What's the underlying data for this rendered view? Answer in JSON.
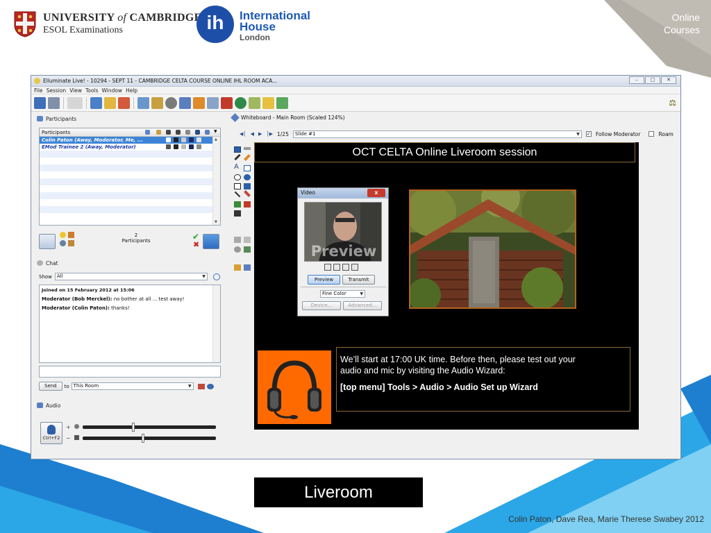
{
  "header": {
    "cambridge_line1a": "UNIVERSITY",
    "cambridge_of": "of",
    "cambridge_line1b": "CAMBRIDGE",
    "cambridge_line2": "ESOL Examinations",
    "ih_mark": "ih",
    "ih_line1": "International",
    "ih_line2": "House",
    "ih_line3": "London",
    "corner_line1": "Online",
    "corner_line2": "Courses"
  },
  "window": {
    "title": "Elluminate Live! - 10294 - SEPT 11 - CAMBRIDGE CELTA COURSE ONLINE IHL ROOM ACA...",
    "controls": [
      "–",
      "□",
      "✕"
    ],
    "menu": [
      "File",
      "Session",
      "View",
      "Tools",
      "Window",
      "Help"
    ]
  },
  "participants": {
    "panel_title": "Participants",
    "column_header": "Participants",
    "rows": [
      "Colin Paton (Away, Moderator, Me, ...",
      "EMod Trainee 2 (Away, Moderator)"
    ],
    "count": "2",
    "count_label": "Participants"
  },
  "chat": {
    "panel_title": "Chat",
    "show_label": "Show",
    "show_value": "All",
    "joined": "Joined on 15 February 2012 at 15:06",
    "messages": [
      {
        "sender": "Moderator (Bob Merckel):",
        "text": " no bother at all ... test away!"
      },
      {
        "sender": "Moderator (Colin Paton):",
        "text": " thanks!"
      }
    ],
    "send_label": "Send",
    "to_label": "to",
    "to_value": "This Room"
  },
  "audio": {
    "panel_title": "Audio",
    "ctrl_label": "Ctrl+F2",
    "plus": "+",
    "minus": "−",
    "mic_level": 0.38,
    "speaker_level": 0.45
  },
  "whiteboard": {
    "panel_title": "Whiteboard - Main Room (Scaled 124%)",
    "page": "1/25",
    "slide": "Slide #1",
    "follow_moderator": "Follow Moderator",
    "roam": "Roam",
    "board_title": "OCT CELTA Online Liveroom session",
    "info_line1": "We’ll start at 17:00 UK time. Before then, please test out your",
    "info_line2": "audio and mic by visiting the Audio Wizard:",
    "info_line3": "[top menu] Tools > Audio > Audio Set up Wizard"
  },
  "video": {
    "title": "Video",
    "close": "x",
    "preview_overlay": "Preview",
    "tab_preview": "Preview",
    "tab_transmit": "Transmit",
    "quality": "Fine Color",
    "device": "Device...",
    "advanced": "Advanced..."
  },
  "footer": {
    "caption": "Liveroom",
    "credit": "Colin Paton, Dave Rea, Marie Therese Swabey 2012"
  },
  "colors": {
    "accent_blue": "#1e88d6",
    "cyan": "#29b5ea",
    "corner_grey": "#a8a49c",
    "orange": "#ff6a00"
  }
}
